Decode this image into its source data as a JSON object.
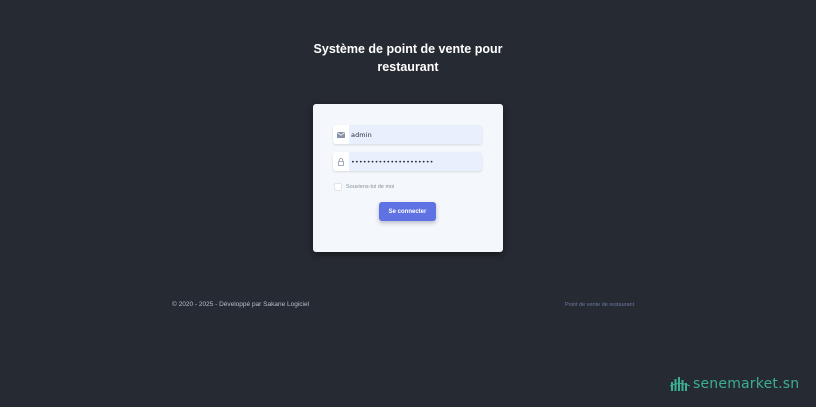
{
  "header": {
    "title_line1": "Système de point de vente pour",
    "title_line2": "restaurant"
  },
  "login_form": {
    "username_value": "admin",
    "username_icon": "envelope-icon",
    "password_value": "•••••••••••••••••••••",
    "password_icon": "lock-icon",
    "remember_label": "Souviens-toi de moi",
    "remember_checked": false,
    "submit_label": "Se connecter"
  },
  "footer": {
    "copyright": "© 2020 - 2025 - Développé par Sakane Logiciel",
    "product_link": "Point de vente de restaurant"
  },
  "watermark": {
    "text": "senemarket.sn"
  },
  "colors": {
    "background": "#262a33",
    "card": "#f4f7fb",
    "input": "#e8f0fe",
    "button": "#5e72e4",
    "watermark": "#3bb08f"
  }
}
